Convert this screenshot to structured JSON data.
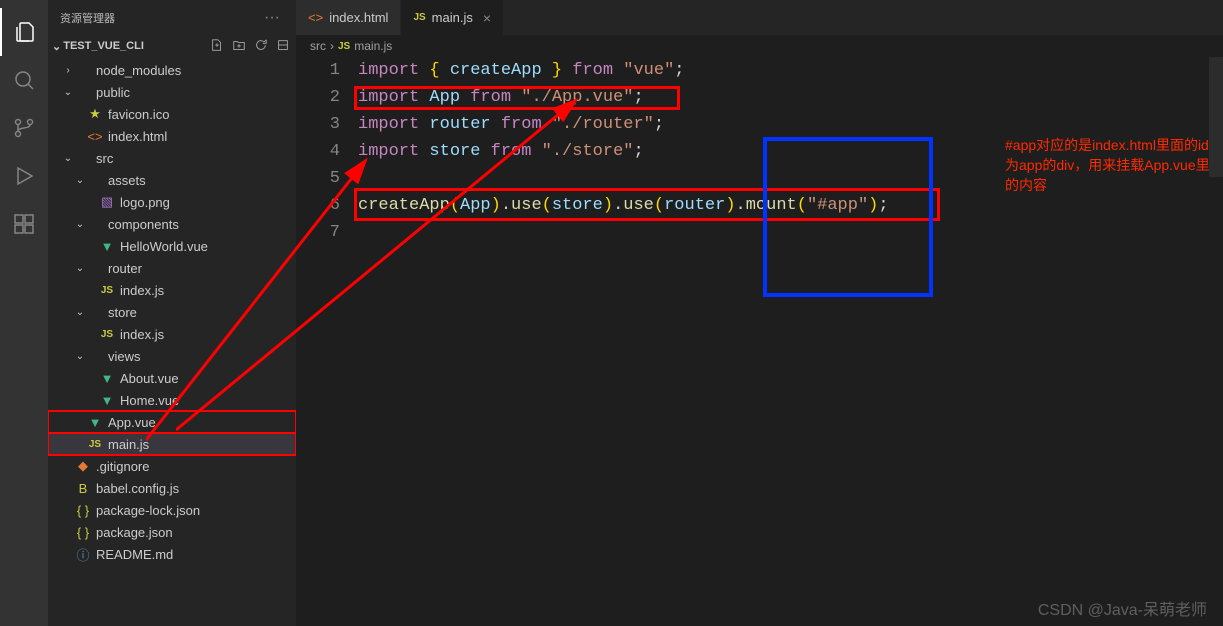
{
  "sidebar": {
    "title": "资源管理器",
    "project": "TEST_VUE_CLI",
    "tree": [
      {
        "label": "node_modules",
        "depth": 0,
        "type": "folder",
        "open": false
      },
      {
        "label": "public",
        "depth": 0,
        "type": "folder",
        "open": true
      },
      {
        "label": "favicon.ico",
        "depth": 1,
        "type": "ico",
        "star": true
      },
      {
        "label": "index.html",
        "depth": 1,
        "type": "html"
      },
      {
        "label": "src",
        "depth": 0,
        "type": "folder",
        "open": true
      },
      {
        "label": "assets",
        "depth": 1,
        "type": "folder",
        "open": true
      },
      {
        "label": "logo.png",
        "depth": 2,
        "type": "png"
      },
      {
        "label": "components",
        "depth": 1,
        "type": "folder",
        "open": true
      },
      {
        "label": "HelloWorld.vue",
        "depth": 2,
        "type": "vue"
      },
      {
        "label": "router",
        "depth": 1,
        "type": "folder",
        "open": true
      },
      {
        "label": "index.js",
        "depth": 2,
        "type": "js"
      },
      {
        "label": "store",
        "depth": 1,
        "type": "folder",
        "open": true
      },
      {
        "label": "index.js",
        "depth": 2,
        "type": "js"
      },
      {
        "label": "views",
        "depth": 1,
        "type": "folder",
        "open": true
      },
      {
        "label": "About.vue",
        "depth": 2,
        "type": "vue"
      },
      {
        "label": "Home.vue",
        "depth": 2,
        "type": "vue"
      },
      {
        "label": "App.vue",
        "depth": 1,
        "type": "vue",
        "highlight": true
      },
      {
        "label": "main.js",
        "depth": 1,
        "type": "js",
        "highlight": true,
        "selected": true
      },
      {
        "label": ".gitignore",
        "depth": 0,
        "type": "git"
      },
      {
        "label": "babel.config.js",
        "depth": 0,
        "type": "babel"
      },
      {
        "label": "package-lock.json",
        "depth": 0,
        "type": "json"
      },
      {
        "label": "package.json",
        "depth": 0,
        "type": "json"
      },
      {
        "label": "README.md",
        "depth": 0,
        "type": "md"
      }
    ]
  },
  "tabs": [
    {
      "label": "index.html",
      "icon": "html",
      "active": false
    },
    {
      "label": "main.js",
      "icon": "js",
      "active": true
    }
  ],
  "breadcrumb": {
    "folder": "src",
    "file": "main.js",
    "fileIcon": "js"
  },
  "code": {
    "lines": [
      [
        {
          "t": "import ",
          "c": "kw"
        },
        {
          "t": "{ ",
          "c": "brace"
        },
        {
          "t": "createApp",
          "c": "var"
        },
        {
          "t": " }",
          "c": "brace"
        },
        {
          "t": " from ",
          "c": "kw"
        },
        {
          "t": "\"vue\"",
          "c": "str"
        },
        {
          "t": ";",
          "c": "punc"
        }
      ],
      [
        {
          "t": "import ",
          "c": "kw"
        },
        {
          "t": "App",
          "c": "var"
        },
        {
          "t": " from ",
          "c": "kw"
        },
        {
          "t": "\"./App.vue\"",
          "c": "str"
        },
        {
          "t": ";",
          "c": "punc"
        }
      ],
      [
        {
          "t": "import ",
          "c": "kw"
        },
        {
          "t": "router",
          "c": "var"
        },
        {
          "t": " from ",
          "c": "kw"
        },
        {
          "t": "\"./router\"",
          "c": "str"
        },
        {
          "t": ";",
          "c": "punc"
        }
      ],
      [
        {
          "t": "import ",
          "c": "kw"
        },
        {
          "t": "store",
          "c": "var"
        },
        {
          "t": " from ",
          "c": "kw"
        },
        {
          "t": "\"./store\"",
          "c": "str"
        },
        {
          "t": ";",
          "c": "punc"
        }
      ],
      [],
      [
        {
          "t": "createApp",
          "c": "fn"
        },
        {
          "t": "(",
          "c": "brace"
        },
        {
          "t": "App",
          "c": "var"
        },
        {
          "t": ")",
          "c": "brace"
        },
        {
          "t": ".",
          "c": "punc"
        },
        {
          "t": "use",
          "c": "fn"
        },
        {
          "t": "(",
          "c": "brace"
        },
        {
          "t": "store",
          "c": "var"
        },
        {
          "t": ")",
          "c": "brace"
        },
        {
          "t": ".",
          "c": "punc"
        },
        {
          "t": "use",
          "c": "fn"
        },
        {
          "t": "(",
          "c": "brace"
        },
        {
          "t": "router",
          "c": "var"
        },
        {
          "t": ")",
          "c": "brace"
        },
        {
          "t": ".",
          "c": "punc"
        },
        {
          "t": "mount",
          "c": "fn"
        },
        {
          "t": "(",
          "c": "brace"
        },
        {
          "t": "\"#app\"",
          "c": "str"
        },
        {
          "t": ")",
          "c": "brace"
        },
        {
          "t": ";",
          "c": "punc"
        }
      ],
      []
    ]
  },
  "annotation": {
    "text": "#app对应的是index.html里面的id为app的div，用来挂载App.vue里的内容"
  },
  "watermark": "CSDN @Java-呆萌老师"
}
